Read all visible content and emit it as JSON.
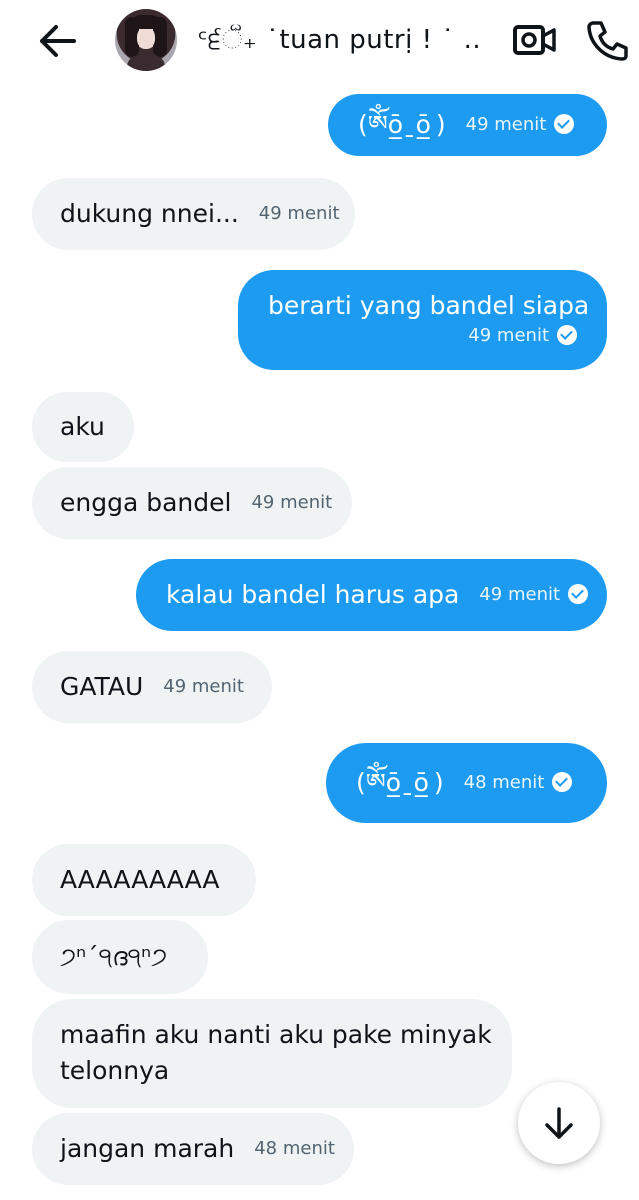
{
  "header": {
    "back_icon": "arrow-left-icon",
    "contact_name": "ᶜ੬ૻ₊ ˙tuan putrị ! ˙ ...",
    "video_icon": "video-camera-icon",
    "call_icon": "phone-icon"
  },
  "messages": [
    {
      "dir": "out",
      "text": "(ༀō̲ˍō̲ )",
      "time": "49 menit",
      "read": true
    },
    {
      "dir": "in",
      "text": "dukung nnei...",
      "time": "49 menit"
    },
    {
      "dir": "out",
      "text": "berarti yang bandel siapa",
      "time": "49 menit",
      "read": true
    },
    {
      "dir": "in",
      "text": "aku",
      "time": ""
    },
    {
      "dir": "in",
      "text": "engga bandel",
      "time": "49 menit"
    },
    {
      "dir": "out",
      "text": "kalau bandel harus apa",
      "time": "49 menit",
      "read": true
    },
    {
      "dir": "in",
      "text": "GATAU",
      "time": "49 menit"
    },
    {
      "dir": "out",
      "text": "(ༀō̲ˍō̲ )",
      "time": "48 menit",
      "read": true
    },
    {
      "dir": "in",
      "text": "AAAAAAAAA",
      "time": ""
    },
    {
      "dir": "in",
      "text": "੭ⁿ´੧ദ੧ⁿ੭",
      "time": ""
    },
    {
      "dir": "in",
      "text": "maafin aku nanti aku pake minyak\ntelonnya",
      "time": ""
    },
    {
      "dir": "in",
      "text": "jangan marah",
      "time": "48 menit"
    }
  ],
  "scroll_down_icon": "arrow-down-icon",
  "colors": {
    "outgoing_bubble": "#1d9bf0",
    "incoming_bubble": "#eff3f4",
    "meta_gray": "#536471"
  }
}
